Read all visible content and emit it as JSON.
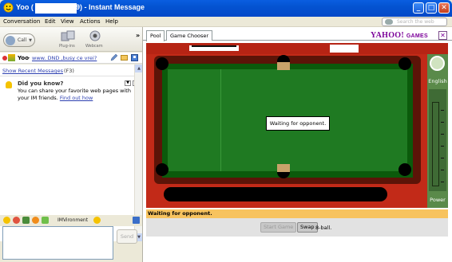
{
  "window": {
    "title_prefix": "Yoo (",
    "title_suffix": "9) - Instant Message",
    "controls": {
      "minimize": "_",
      "maximize": "□",
      "close": "✕"
    }
  },
  "menu": {
    "items": [
      "Conversation",
      "Edit",
      "View",
      "Actions",
      "Help"
    ],
    "search_placeholder": "Search the web"
  },
  "toolbar": {
    "call_label": "Call",
    "plugins_label": "Plug-ins",
    "webcam_label": "Webcam",
    "more_label": "»"
  },
  "contact": {
    "name": "Yoo",
    "separator": "-",
    "status_message": "www. DND ,busy ce vrei?"
  },
  "history": {
    "show_recent_label": "Show Recent Messages",
    "show_recent_shortcut": "(F3)",
    "tip": {
      "heading": "Did you know?",
      "body": "You can share your favorite web pages with your IM friends.",
      "link": "Find out how"
    }
  },
  "composer": {
    "imvironment_label": "IMVironment",
    "send_label": "Send",
    "input_value": ""
  },
  "tabs": {
    "items": [
      "Pool",
      "Game Chooser"
    ],
    "active": "Pool",
    "brand": "YAHOO!",
    "brand_suffix": "GAMES"
  },
  "game": {
    "waiting_dialog": "Waiting for opponent.",
    "english_label": "English",
    "power_label": "Power",
    "status_line": "Waiting for opponent.",
    "start_game_label": "Start Game",
    "swap_label": "Swap",
    "mode_label": "8-ball."
  },
  "colors": {
    "titlebar": "#0453d1",
    "table_felt": "#1f7a22",
    "table_rail": "#c22a18",
    "status_bar": "#f7c35f",
    "brand": "#7b0099"
  }
}
